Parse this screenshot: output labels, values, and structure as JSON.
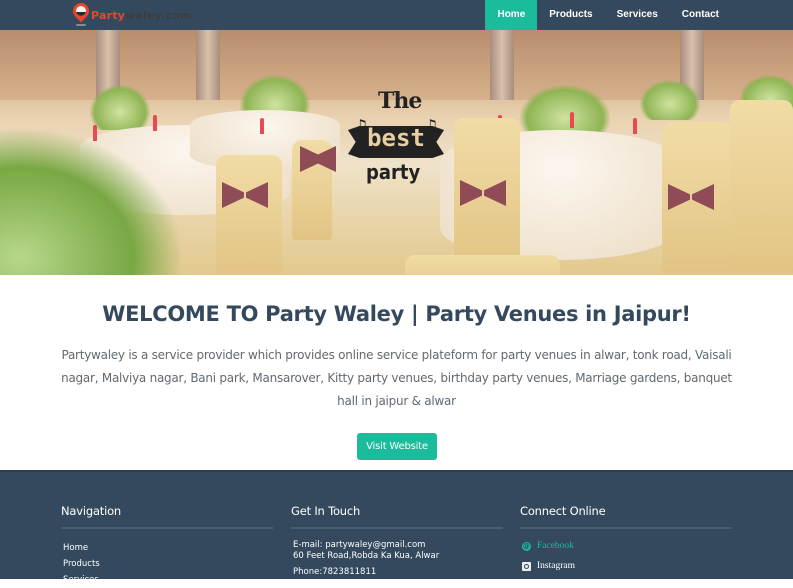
{
  "brand": {
    "name_part1": "Party",
    "name_part2": "waley.com"
  },
  "nav": {
    "items": [
      {
        "label": "Home",
        "active": true
      },
      {
        "label": "Products",
        "active": false
      },
      {
        "label": "Services",
        "active": false
      },
      {
        "label": "Contact",
        "active": false
      }
    ]
  },
  "hero": {
    "badge_line1": "The",
    "badge_line2": "best",
    "badge_line3": "party",
    "note_glyph": "♫"
  },
  "welcome": {
    "title": "WELCOME TO Party Waley | Party Venues in Jaipur!",
    "text": "Partywaley is a service provider which provides online service plateform for party venues in alwar, tonk road, Vaisali nagar, Malviya nagar, Bani park, Mansarover, Kitty party venues, birthday party venues, Marriage gardens, banquet hall in jaipur & alwar",
    "button_label": "Visit Website"
  },
  "footer": {
    "navigation": {
      "heading": "Navigation",
      "items": [
        "Home",
        "Products",
        "Services"
      ]
    },
    "contact": {
      "heading": "Get In Touch",
      "email": "E-mail: partywaley@gmail.com",
      "address": "60 Feet Road,Robda Ka Kua, Alwar",
      "phone": "Phone:7823811811"
    },
    "connect": {
      "heading": "Connect Online",
      "links": [
        {
          "label": "Facebook",
          "icon": "facebook-icon",
          "glyph": "@"
        },
        {
          "label": "Instagram",
          "icon": "instagram-icon",
          "glyph": ""
        }
      ]
    }
  },
  "colors": {
    "navbar_bg": "#34495e",
    "accent": "#1abc9c",
    "brand_red": "#e8452c",
    "heading_text": "#34495e",
    "body_text": "#5f6a73"
  }
}
